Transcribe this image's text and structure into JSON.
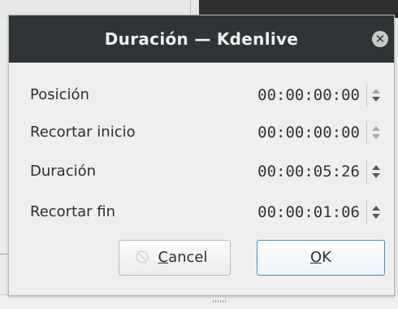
{
  "window": {
    "title": "Duración — Kdenlive",
    "close_glyph": "✕"
  },
  "fields": [
    {
      "label": "Posición",
      "value": "00:00:00:00"
    },
    {
      "label": "Recortar inicio",
      "value": "00:00:00:00"
    },
    {
      "label": "Duración",
      "value": "00:00:05:26"
    },
    {
      "label": "Recortar fin",
      "value": "00:00:01:06"
    }
  ],
  "buttons": {
    "cancel": {
      "mnemonic": "C",
      "rest": "ancel",
      "icon": "cancel-icon"
    },
    "ok": {
      "mnemonic": "O",
      "rest": "K"
    }
  },
  "colors": {
    "titlebar": "#2f3437",
    "ok_border": "#3a8fd6"
  }
}
